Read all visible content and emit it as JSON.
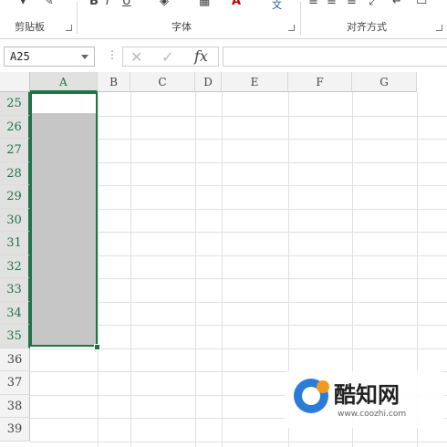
{
  "ribbon": {
    "groups": [
      {
        "label": "剪贴板"
      },
      {
        "label": "字体"
      },
      {
        "label": "对齐方式"
      }
    ],
    "glyphs": [
      "B",
      "I",
      "U",
      "A",
      "文"
    ]
  },
  "formula_bar": {
    "name_box": "A25",
    "dots": "⋮",
    "cancel": "✕",
    "enter": "✓",
    "fx": "fx",
    "value": ""
  },
  "columns": [
    "A",
    "B",
    "C",
    "D",
    "E",
    "F",
    "G"
  ],
  "selected_column": "A",
  "rows": [
    "25",
    "26",
    "27",
    "28",
    "29",
    "30",
    "31",
    "32",
    "33",
    "34",
    "35",
    "36",
    "37",
    "38",
    "39"
  ],
  "selection": {
    "start": "A25",
    "end": "A35"
  },
  "watermark": {
    "title": "酷知网",
    "url": "www.coozhi.com"
  },
  "colors": {
    "accent": "#217346",
    "selection_fill": "#c6c6c6"
  }
}
